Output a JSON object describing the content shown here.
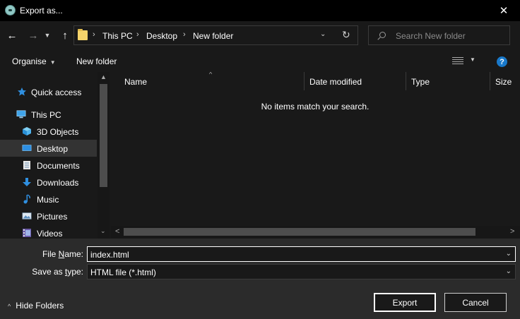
{
  "window": {
    "title": "Export as...",
    "close_glyph": "✕"
  },
  "nav": {
    "back_glyph": "←",
    "forward_glyph": "→",
    "recent_glyph": "▼",
    "up_glyph": "↑",
    "breadcrumbs": [
      "This PC",
      "Desktop",
      "New folder"
    ],
    "separator": "›",
    "dropdown_glyph": "⌄",
    "refresh_glyph": "↻"
  },
  "search": {
    "placeholder": "Search New folder"
  },
  "toolbar": {
    "organise_label": "Organise",
    "caret_glyph": "▼",
    "new_folder_label": "New folder",
    "help_glyph": "?"
  },
  "sidebar": {
    "items": [
      {
        "label": "Quick access",
        "icon": "star-icon",
        "selected": false
      },
      {
        "label": "This PC",
        "icon": "computer-icon",
        "selected": false
      },
      {
        "label": "3D Objects",
        "icon": "cube-icon",
        "selected": false
      },
      {
        "label": "Desktop",
        "icon": "desktop-icon",
        "selected": true
      },
      {
        "label": "Documents",
        "icon": "document-icon",
        "selected": false
      },
      {
        "label": "Downloads",
        "icon": "download-icon",
        "selected": false
      },
      {
        "label": "Music",
        "icon": "music-icon",
        "selected": false
      },
      {
        "label": "Pictures",
        "icon": "picture-icon",
        "selected": false
      },
      {
        "label": "Videos",
        "icon": "video-icon",
        "selected": false
      }
    ],
    "scroll_up_glyph": "▲",
    "scroll_down_glyph": "⌄"
  },
  "file_list": {
    "columns": [
      "Name",
      "Date modified",
      "Type",
      "Size"
    ],
    "sort_glyph": "^",
    "empty_message": "No items match your search.",
    "scroll_left_glyph": "<",
    "scroll_right_glyph": ">"
  },
  "form": {
    "file_name_label_underlined": "N",
    "file_name_label_prefix": "File ",
    "file_name_label_suffix": "ame:",
    "file_name_value": "index.html",
    "save_type_label_prefix": "Save as ",
    "save_type_label_underlined": "t",
    "save_type_label_suffix": "ype:",
    "save_type_value": "HTML file (*.html)",
    "dropdown_glyph": "⌄"
  },
  "footer": {
    "hide_folders_glyph": "^",
    "hide_folders_label": "Hide Folders",
    "export_label": "Export",
    "cancel_label": "Cancel"
  },
  "colors": {
    "accent": "#1979ca",
    "selection": "#333333",
    "folder": "#f5d46b"
  }
}
